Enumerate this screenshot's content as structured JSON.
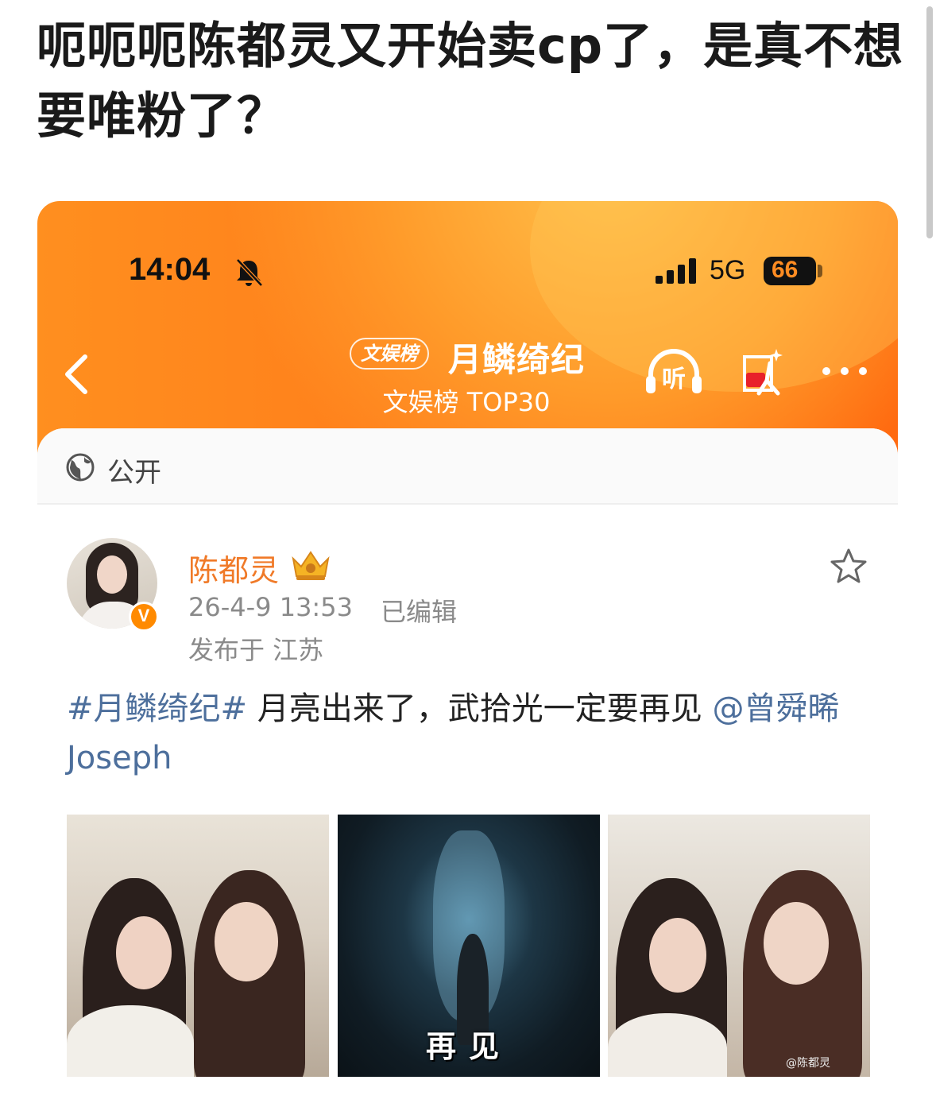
{
  "post": {
    "title": "呃呃呃陈都灵又开始卖cp了，是真不想要唯粉了？"
  },
  "status_bar": {
    "time": "14:04",
    "network": "5G",
    "battery": "66"
  },
  "nav": {
    "badge": "文娱榜",
    "title": "月鳞绮纪",
    "subtitle": "文娱榜 TOP30",
    "listen_label": "听"
  },
  "visibility": {
    "label": "公开"
  },
  "author": {
    "name": "陈都灵",
    "verified_mark": "V",
    "timestamp": "26-4-9 13:53",
    "edited": "已编辑",
    "location": "发布于 江苏"
  },
  "content": {
    "hashtag": "#月鳞绮纪#",
    "text": " 月亮出来了，武拾光一定要再见 ",
    "mention": "@曾舜晞 Joseph"
  },
  "images": [
    {
      "caption": ""
    },
    {
      "caption": "再见"
    },
    {
      "caption": "",
      "watermark": "@陈都灵"
    }
  ],
  "colors": {
    "header_orange": "#ff7a1a",
    "username": "#f07a28",
    "link_blue": "#4d6f9c"
  },
  "icons": [
    "bell-slash-icon",
    "signal-icon",
    "back-icon",
    "headphones-icon",
    "red-packet-icon",
    "more-icon",
    "globe-icon",
    "crown-icon",
    "star-icon"
  ]
}
